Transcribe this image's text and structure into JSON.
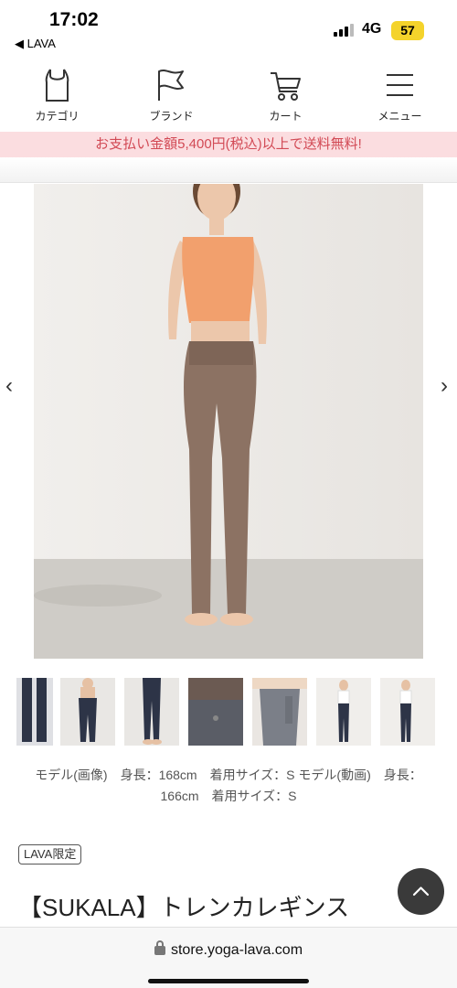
{
  "status": {
    "time": "17:02",
    "back_label": "◀ LAVA",
    "network": "4G",
    "battery": "57"
  },
  "nav": {
    "items": [
      {
        "label": "カテゴリ",
        "icon": "tank-top-icon"
      },
      {
        "label": "ブランド",
        "icon": "flag-icon"
      },
      {
        "label": "カート",
        "icon": "cart-icon"
      },
      {
        "label": "メニュー",
        "icon": "menu-icon"
      }
    ]
  },
  "promo": {
    "text": "お支払い金額5,400円(税込)以上で送料無料!"
  },
  "gallery": {
    "prev_label": "‹",
    "next_label": "›",
    "thumbnails": [
      "navy-leggings-front",
      "navy-leggings-model",
      "navy-leggings-full",
      "waistband-detail",
      "pocket-detail",
      "model-white-top-1",
      "model-white-top-2"
    ]
  },
  "product": {
    "model_caption": "モデル(画像)　身長：168cm　着用サイズ：S モデル(動画)　身長：166cm　着用サイズ：S",
    "badge": "LAVA限定",
    "title": "【SUKALA】トレンカレギンス"
  },
  "url": {
    "text": "store.yoga-lava.com"
  },
  "colors": {
    "promo_bg": "#fbdde0",
    "promo_text": "#d24a55",
    "battery": "#f4d32b"
  }
}
